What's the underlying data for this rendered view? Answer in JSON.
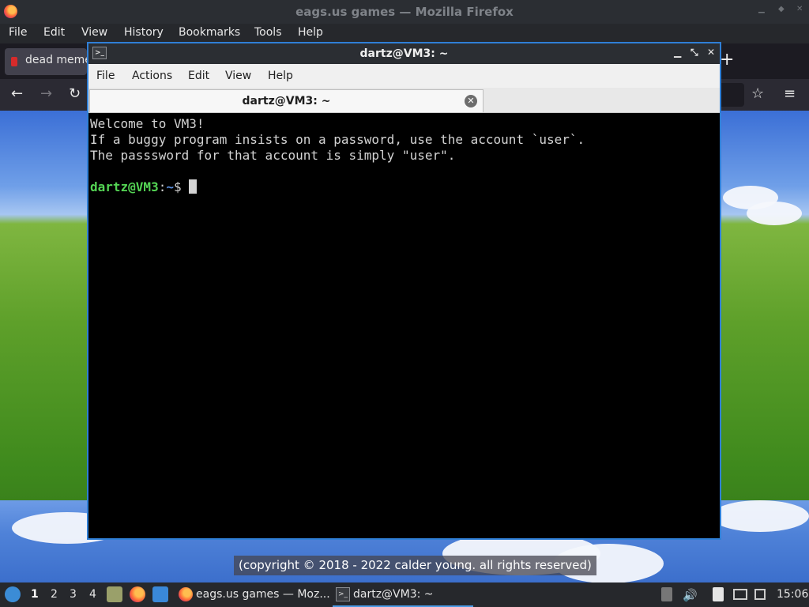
{
  "firefox": {
    "window_title": "eags.us games — Mozilla Firefox",
    "menu": [
      "File",
      "Edit",
      "View",
      "History",
      "Bookmarks",
      "Tools",
      "Help"
    ],
    "tab_label": "dead meme",
    "page_footer": "(copyright © 2018 - 2022 calder young. all rights reserved)"
  },
  "terminal": {
    "window_title": "dartz@VM3: ~",
    "menu": [
      "File",
      "Actions",
      "Edit",
      "View",
      "Help"
    ],
    "tab_label": "dartz@VM3: ~",
    "lines": [
      "Welcome to VM3!",
      "If a buggy program insists on a password, use the account `user`.",
      "The passsword for that account is simply \"user\"."
    ],
    "prompt_user": "dartz@VM3",
    "prompt_sep": ":",
    "prompt_path": "~",
    "prompt_symbol": "$ "
  },
  "taskbar": {
    "workspaces": [
      "1",
      "2",
      "3",
      "4"
    ],
    "tasks": [
      {
        "label": "eags.us games — Moz..."
      },
      {
        "label": "dartz@VM3: ~"
      }
    ],
    "clock": "15:06"
  }
}
